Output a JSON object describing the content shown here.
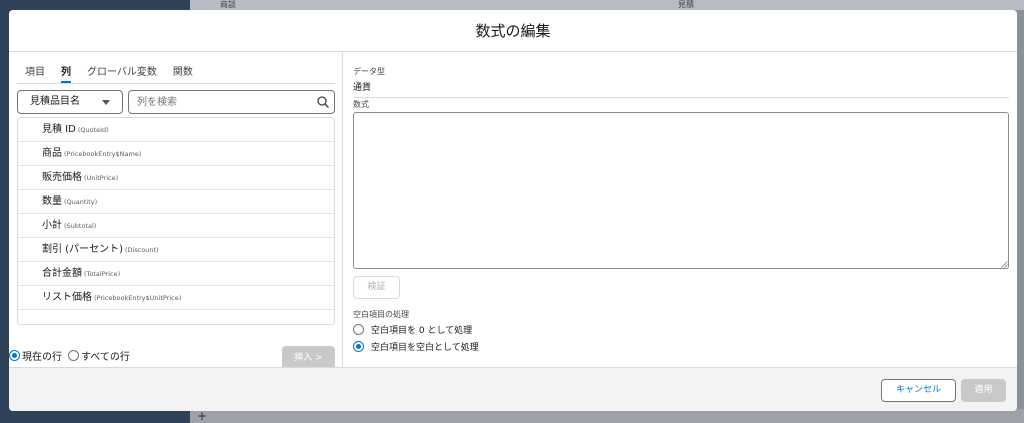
{
  "background": {
    "header_col1": "商談",
    "header_col2": "見積",
    "add_symbol": "+"
  },
  "modal": {
    "title": "数式の編集",
    "tabs": [
      {
        "label": "項目",
        "active": false
      },
      {
        "label": "列",
        "active": true
      },
      {
        "label": "グローバル変数",
        "active": false
      },
      {
        "label": "関数",
        "active": false
      }
    ],
    "object_select": "見積品目名",
    "search_placeholder": "列を検索",
    "fields": [
      {
        "label": "見積 ID",
        "api": "(QuoteId)"
      },
      {
        "label": "商品",
        "api": "(PricebookEntry$Name)"
      },
      {
        "label": "販売価格",
        "api": "(UnitPrice)"
      },
      {
        "label": "数量",
        "api": "(Quantity)"
      },
      {
        "label": "小計",
        "api": "(Subtotal)"
      },
      {
        "label": "割引 (パーセント)",
        "api": "(Discount)"
      },
      {
        "label": "合計金額",
        "api": "(TotalPrice)"
      },
      {
        "label": "リスト価格",
        "api": "(PricebookEntry$UnitPrice)"
      }
    ],
    "row_scope": {
      "current_row": "現在の行",
      "all_rows": "すべての行",
      "selected": "current_row"
    },
    "insert_button": "挿入 >",
    "data_type_label": "データ型",
    "data_type_value": "通貨",
    "formula_label": "数式",
    "formula_value": "",
    "verify_button": "検証",
    "blank_handling_label": "空白項目の処理",
    "blank_options": [
      {
        "label": "空白項目を 0 として処理",
        "checked": false
      },
      {
        "label": "空白項目を空白として処理",
        "checked": true
      }
    ],
    "cancel_button": "キャンセル",
    "apply_button": "適用"
  },
  "colors": {
    "accent": "#0176d3",
    "disabled_button": "#c9c9c9"
  }
}
